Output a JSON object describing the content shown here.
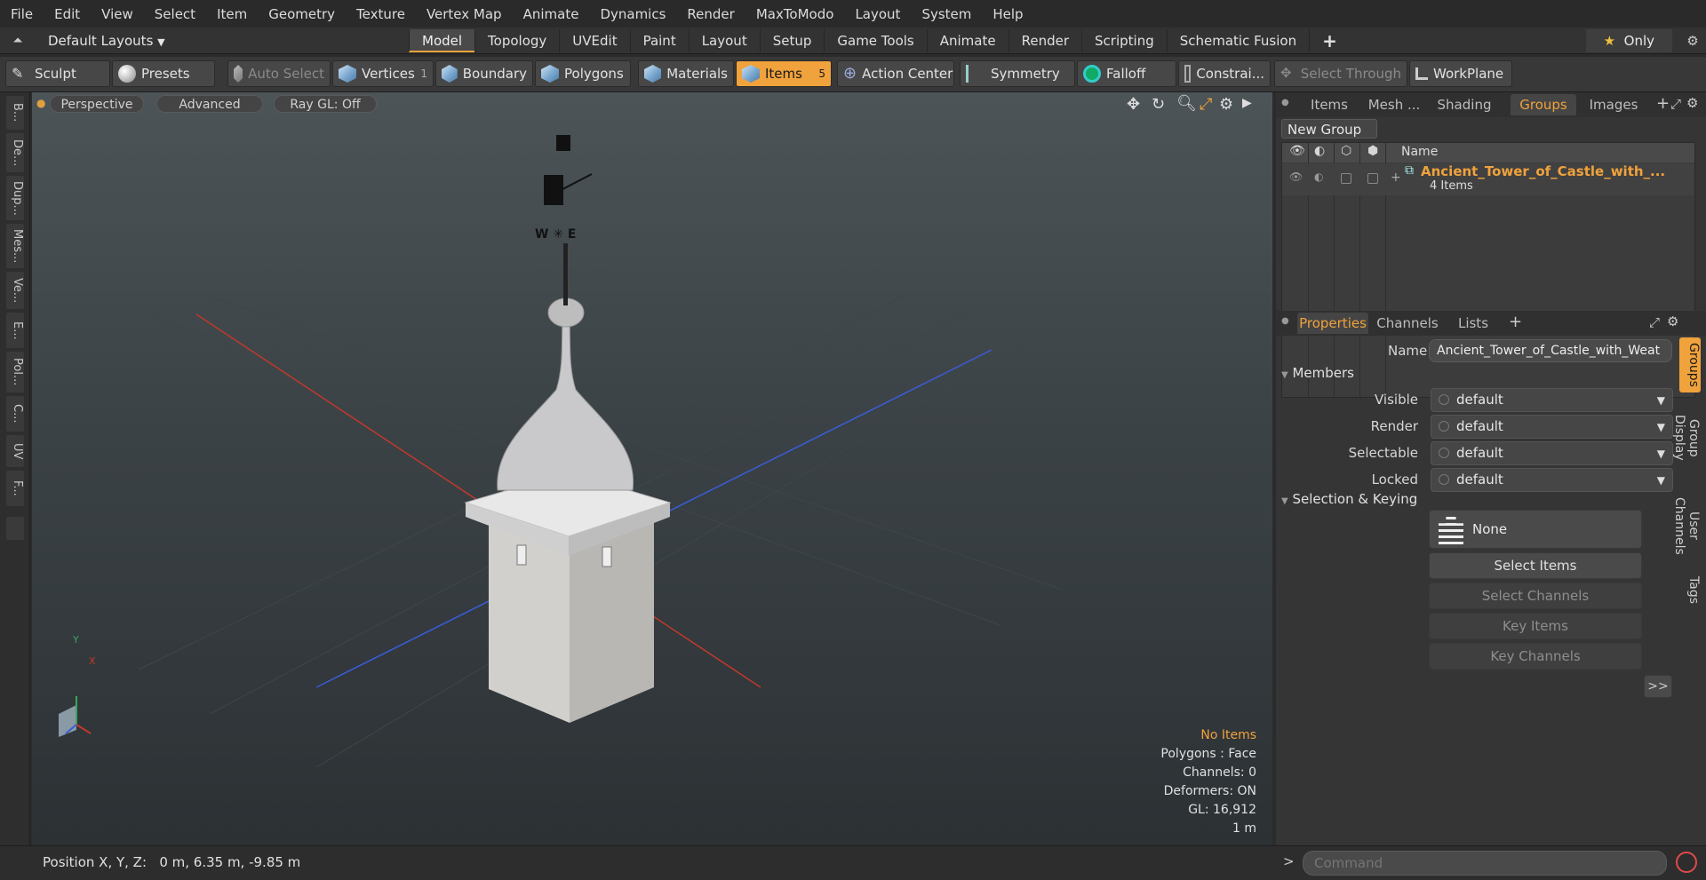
{
  "menu": [
    "File",
    "Edit",
    "View",
    "Select",
    "Item",
    "Geometry",
    "Texture",
    "Vertex Map",
    "Animate",
    "Dynamics",
    "Render",
    "MaxToModo",
    "Layout",
    "System",
    "Help"
  ],
  "layout_bar": {
    "preset": "Default Layouts",
    "tabs": [
      "Model",
      "Topology",
      "UVEdit",
      "Paint",
      "Layout",
      "Setup",
      "Game Tools",
      "Animate",
      "Render",
      "Scripting",
      "Schematic Fusion"
    ],
    "active_tab": "Model",
    "add": "+",
    "only": "Only"
  },
  "toolbar": {
    "sculpt": "Sculpt",
    "presets": "Presets",
    "auto_select": "Auto Select",
    "vertices": "Vertices",
    "vertices_count": "1",
    "boundary": "Boundary",
    "polygons": "Polygons",
    "materials": "Materials",
    "items": "Items",
    "items_count": "5",
    "action_center": "Action Center",
    "symmetry": "Symmetry",
    "falloff": "Falloff",
    "constraints": "Constrai...",
    "select_through": "Select Through",
    "workplane": "WorkPlane"
  },
  "left_tabs": [
    "B...",
    "De...",
    "Dup...",
    "Mes...",
    "Ve...",
    "E...",
    "Pol...",
    "C...",
    "UV",
    "F..."
  ],
  "viewport": {
    "view": "Perspective",
    "shading": "Advanced",
    "raygl": "Ray GL: Off",
    "hud": {
      "items": "No Items",
      "polygons": "Polygons : Face",
      "channels": "Channels: 0",
      "deformers": "Deformers: ON",
      "gl": "GL: 16,912",
      "scale": "1 m"
    },
    "axis_y": "Y",
    "axis_x": "X"
  },
  "status": {
    "position": "Position X, Y, Z:   0 m, 6.35 m, -9.85 m",
    "command_placeholder": "Command"
  },
  "groups_panel": {
    "tabs": [
      "Items",
      "Mesh ...",
      "Shading",
      "Groups",
      "Images"
    ],
    "active_tab": "Groups",
    "new_group": "New Group",
    "col_name": "Name",
    "group_name": "Ancient_Tower_of_Castle_with_...",
    "group_count": "4 Items"
  },
  "properties_panel": {
    "tabs": [
      "Properties",
      "Channels",
      "Lists"
    ],
    "active_tab": "Properties",
    "name_label": "Name",
    "name_value": "Ancient_Tower_of_Castle_with_Weat",
    "members_section": "Members",
    "visible_label": "Visible",
    "visible_value": "default",
    "render_label": "Render",
    "render_value": "default",
    "selectable_label": "Selectable",
    "selectable_value": "default",
    "locked_label": "Locked",
    "locked_value": "default",
    "sel_keying_section": "Selection & Keying",
    "none_label": "None",
    "select_items": "Select Items",
    "select_channels": "Select Channels",
    "key_items": "Key Items",
    "key_channels": "Key Channels",
    "more": ">>"
  },
  "side_tabs": [
    "Groups",
    "Group Display",
    "User Channels",
    "Tags"
  ],
  "colors": {
    "accent": "#f0a23c",
    "x_axis": "#c0392b",
    "z_axis": "#3b5bd6"
  }
}
